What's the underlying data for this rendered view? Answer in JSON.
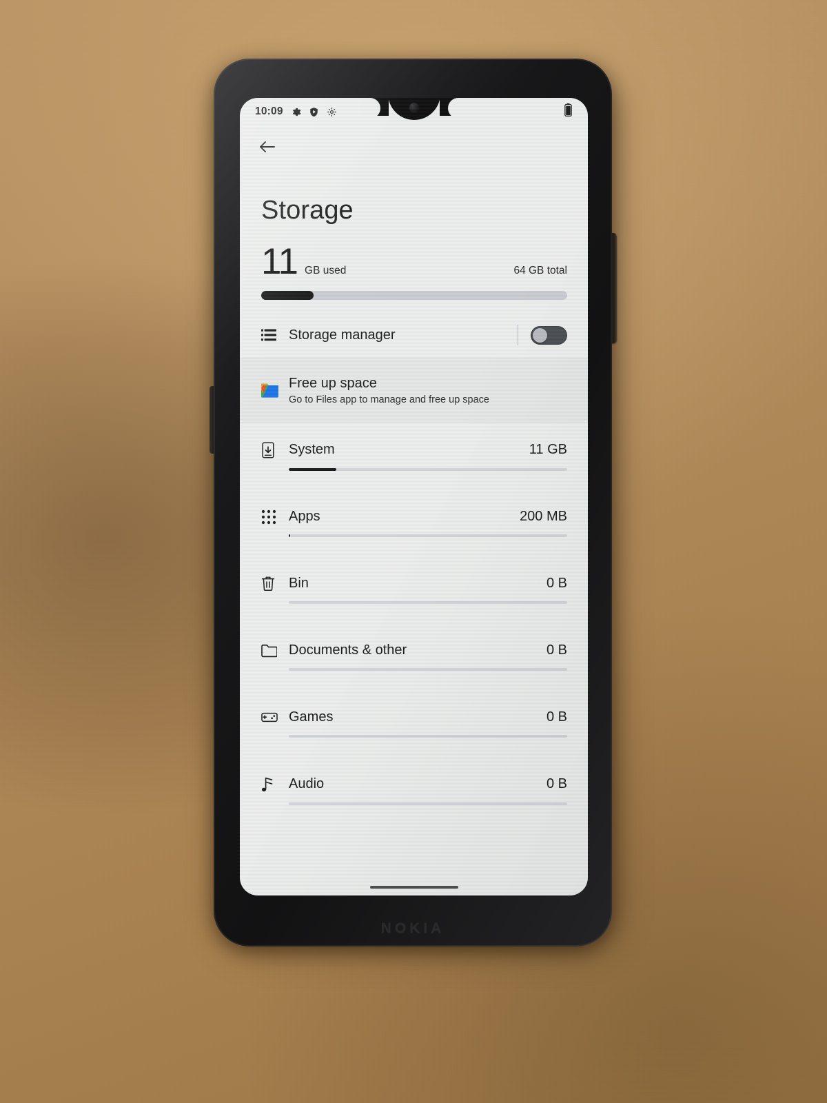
{
  "device": {
    "brand": "NOKIA"
  },
  "statusbar": {
    "clock": "10:09",
    "icons": [
      "gear-filled-icon",
      "play-protect-shield-icon",
      "gear-outline-icon"
    ],
    "battery": "battery-icon"
  },
  "nav": {
    "back_label": "back-arrow-icon"
  },
  "header": {
    "title": "Storage"
  },
  "summary": {
    "used_number": "11",
    "used_label": "GB used",
    "total_label": "64 GB total",
    "used_percent": 17.2
  },
  "storage_manager": {
    "label": "Storage manager",
    "toggle_state": "off",
    "icon": "list-lines-icon"
  },
  "free_up_space": {
    "title": "Free up space",
    "subtitle": "Go to Files app to manage and free up space",
    "icon": "files-app-icon"
  },
  "categories": [
    {
      "label": "System",
      "value": "11 GB",
      "icon": "phone-download-icon",
      "percent": 17.0
    },
    {
      "label": "Apps",
      "value": "200 MB",
      "icon": "apps-grid-icon",
      "percent": 0.4
    },
    {
      "label": "Bin",
      "value": "0 B",
      "icon": "trash-icon",
      "percent": 0
    },
    {
      "label": "Documents & other",
      "value": "0 B",
      "icon": "folder-icon",
      "percent": 0
    },
    {
      "label": "Games",
      "value": "0 B",
      "icon": "gamepad-icon",
      "percent": 0
    },
    {
      "label": "Audio",
      "value": "0 B",
      "icon": "music-note-icon",
      "percent": 0
    }
  ],
  "colors": {
    "screen_bg": "#eceeed",
    "text_primary": "#1c1c1c",
    "bar_fill": "#1b1b1b",
    "bar_track": "#c9ccd1",
    "highlight_row": "#e4e7e5",
    "switch_track_off": "#4b5054",
    "switch_knob": "#b8bcc0",
    "desk_bg": "#b08a58"
  }
}
